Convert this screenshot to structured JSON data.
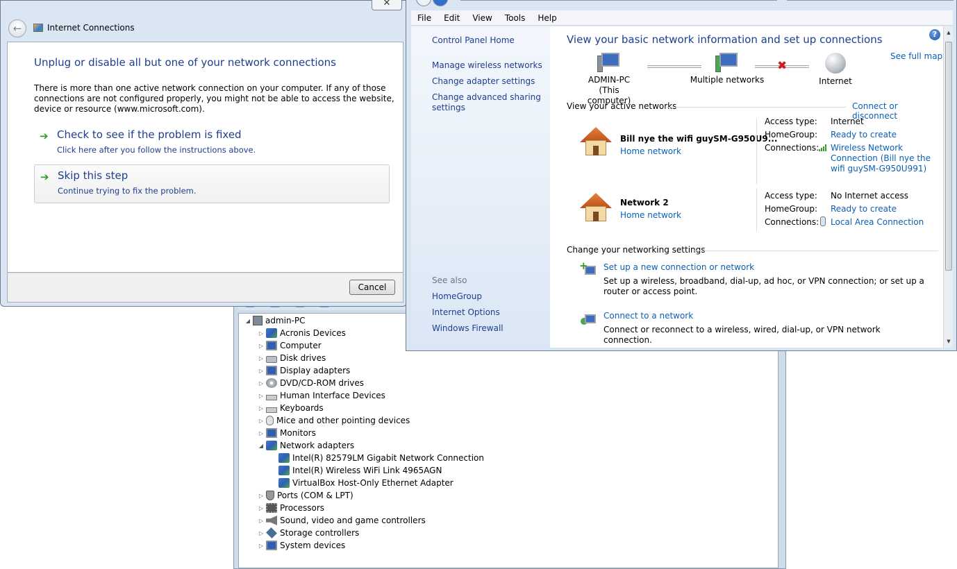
{
  "device_manager": {
    "root": "admin-PC",
    "items": [
      {
        "label": "Acronis Devices",
        "arrow": "▷",
        "icon": "net"
      },
      {
        "label": "Computer",
        "arrow": "▷",
        "icon": "monitor"
      },
      {
        "label": "Disk drives",
        "arrow": "▷",
        "icon": "disk"
      },
      {
        "label": "Display adapters",
        "arrow": "▷",
        "icon": "monitor"
      },
      {
        "label": "DVD/CD-ROM drives",
        "arrow": "▷",
        "icon": "dvd"
      },
      {
        "label": "Human Interface Devices",
        "arrow": "▷",
        "icon": "kb"
      },
      {
        "label": "Keyboards",
        "arrow": "▷",
        "icon": "kb"
      },
      {
        "label": "Mice and other pointing devices",
        "arrow": "▷",
        "icon": "mouse"
      },
      {
        "label": "Monitors",
        "arrow": "▷",
        "icon": "monitor"
      },
      {
        "label": "Network adapters",
        "arrow": "◢",
        "icon": "net"
      }
    ],
    "network_children": [
      "Intel(R) 82579LM Gigabit Network Connection",
      "Intel(R) Wireless WiFi Link 4965AGN",
      "VirtualBox Host-Only Ethernet Adapter"
    ],
    "items_after": [
      {
        "label": "Ports (COM & LPT)",
        "icon": "port"
      },
      {
        "label": "Processors",
        "icon": "chip"
      },
      {
        "label": "Sound, video and game controllers",
        "icon": "speaker"
      },
      {
        "label": "Storage controllers",
        "icon": "storage"
      },
      {
        "label": "System devices",
        "icon": "monitor"
      }
    ]
  },
  "inet": {
    "close_glyph": "✕",
    "back_glyph": "←",
    "title": "Internet Connections",
    "heading": "Unplug or disable all but one of your network connections",
    "description": "There is more than one active network connection on your computer. If any of those connections are not configured properly, you might not be able to access the website, device or resource (www.microsoft.com).",
    "check": {
      "label": "Check to see if the problem is fixed",
      "sub": "Click here after you follow the instructions above."
    },
    "skip": {
      "label": "Skip this step",
      "sub": "Continue trying to fix the problem."
    },
    "arrow_glyph": "➔",
    "cancel": "Cancel"
  },
  "net": {
    "menu": [
      "File",
      "Edit",
      "View",
      "Tools",
      "Help"
    ],
    "left": {
      "home": "Control Panel Home",
      "links": [
        "Manage wireless networks",
        "Change adapter settings",
        "Change advanced sharing settings"
      ],
      "see_also": "See also",
      "see_also_links": [
        "HomeGroup",
        "Internet Options",
        "Windows Firewall"
      ]
    },
    "help_glyph": "?",
    "title": "View your basic network information and set up connections",
    "see_full_map": "See full map",
    "map": {
      "computer": "ADMIN-PC",
      "computer_sub": "(This computer)",
      "networks": "Multiple networks",
      "internet": "Internet",
      "broken_glyph": "✖"
    },
    "active_head": "View your active networks",
    "connect_disconnect": "Connect or disconnect",
    "networks": [
      {
        "name": "Bill nye the wifi guySM-G950U9...",
        "type": "Home network",
        "access_label": "Access type:",
        "access": "Internet",
        "homegroup_label": "HomeGroup:",
        "homegroup": "Ready to create",
        "connections_label": "Connections:",
        "connection": "Wireless Network Connection (Bill nye the wifi guySM-G950U991)"
      },
      {
        "name": "Network  2",
        "type": "Home network",
        "access_label": "Access type:",
        "access": "No Internet access",
        "homegroup_label": "HomeGroup:",
        "homegroup": "Ready to create",
        "connections_label": "Connections:",
        "connection": "Local Area Connection"
      }
    ],
    "change_head": "Change your networking settings",
    "tasks": [
      {
        "title": "Set up a new connection or network",
        "desc": "Set up a wireless, broadband, dial-up, ad hoc, or VPN connection; or set up a router or access point."
      },
      {
        "title": "Connect to a network",
        "desc": "Connect or reconnect to a wireless, wired, dial-up, or VPN network connection."
      }
    ],
    "scroll_up_glyph": "▲",
    "scroll_down_glyph": "▼"
  },
  "colors": {
    "link": "#0b5fb3",
    "heading": "#1e3d8f",
    "chrome": "#dbe6f4"
  }
}
